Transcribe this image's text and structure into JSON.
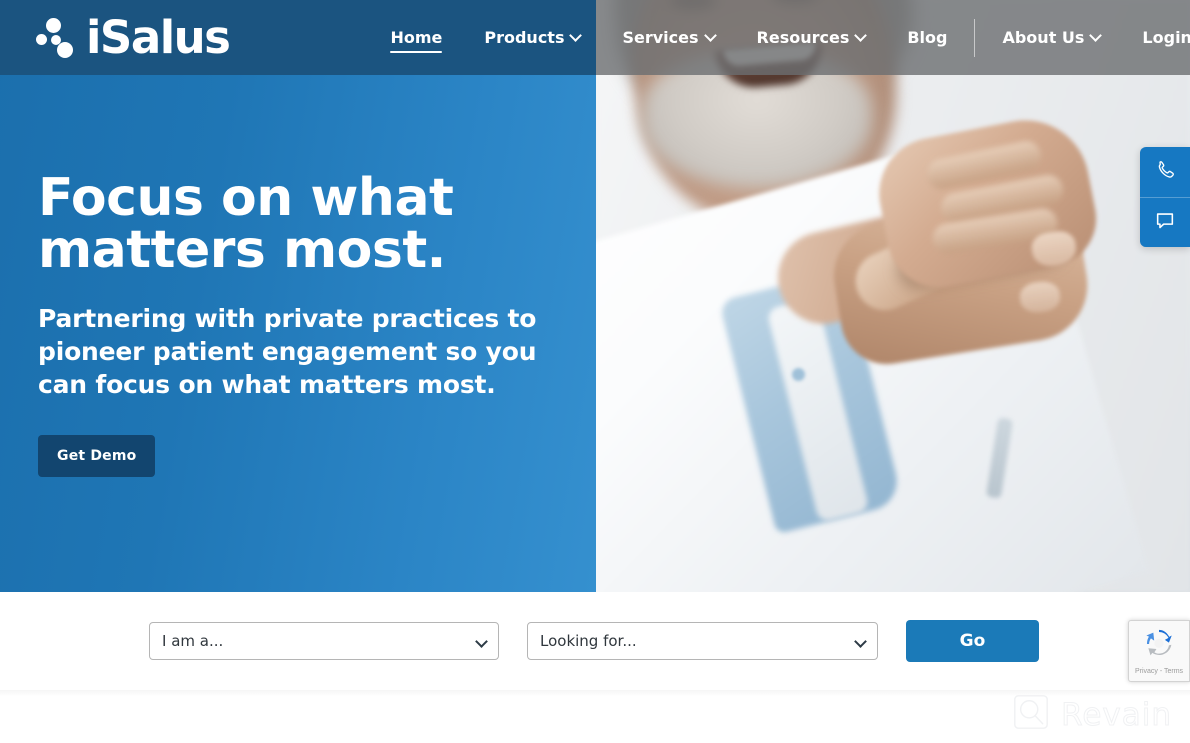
{
  "brand": {
    "name": "iSalus",
    "logo_icon": "isalus-dots-logo"
  },
  "nav": {
    "items": [
      {
        "label": "Home",
        "has_dropdown": false,
        "active": true
      },
      {
        "label": "Products",
        "has_dropdown": true,
        "active": false
      },
      {
        "label": "Services",
        "has_dropdown": true,
        "active": false
      },
      {
        "label": "Resources",
        "has_dropdown": true,
        "active": false
      },
      {
        "label": "Blog",
        "has_dropdown": false,
        "active": false
      },
      {
        "label": "About Us",
        "has_dropdown": true,
        "active": false
      },
      {
        "label": "Login",
        "has_dropdown": true,
        "active": false
      }
    ],
    "search_icon": "search-icon"
  },
  "hero": {
    "title_line1": "Focus on what",
    "title_line2": "matters most.",
    "subtitle": "Partnering with private practices to pioneer patient engagement so you can focus on what matters most.",
    "cta_label": "Get Demo",
    "panel_color_start": "#1b6fad",
    "panel_color_end": "#3590cf",
    "cta_color": "#12456f",
    "image_alt": "smiling-doctor-handshake-photo"
  },
  "side_tabs": [
    {
      "icon": "phone-icon",
      "name": "call-tab"
    },
    {
      "icon": "chat-bubble-icon",
      "name": "chat-tab"
    }
  ],
  "filter_bar": {
    "i_am_a": {
      "value": "I am a...",
      "options": [
        "I am a..."
      ]
    },
    "looking_for": {
      "value": "Looking for...",
      "options": [
        "Looking for..."
      ]
    },
    "go_label": "Go",
    "go_color": "#1b7ab8"
  },
  "recaptcha": {
    "legal": "Privacy - Terms",
    "icon": "recaptcha-icon"
  },
  "watermark": {
    "text": "Revain",
    "icon": "revain-logo-icon"
  }
}
